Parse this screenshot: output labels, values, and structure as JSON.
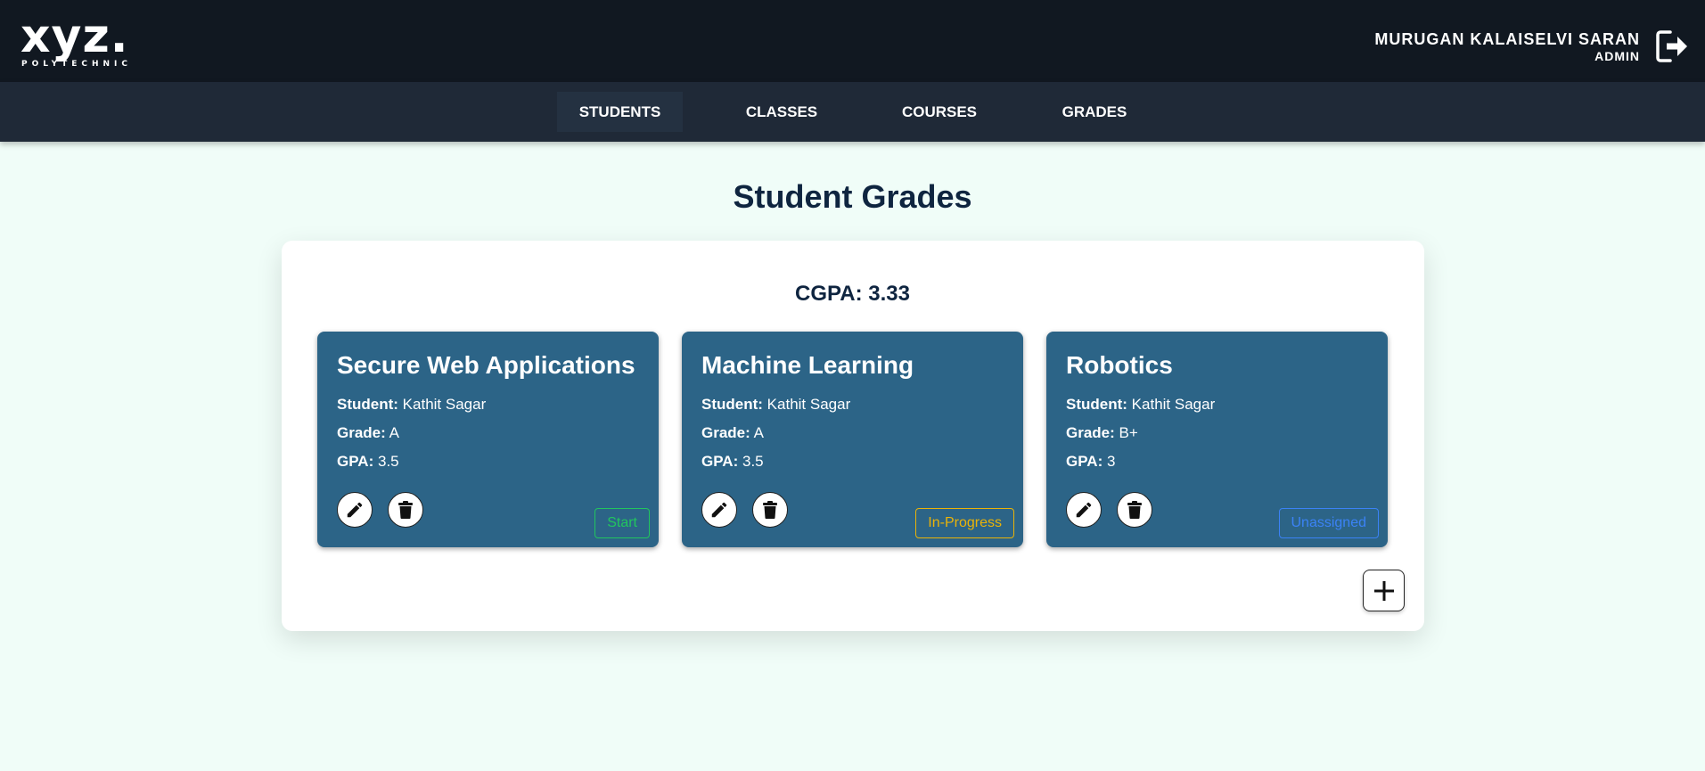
{
  "header": {
    "logo_text": "xyz.",
    "logo_subtext": "POLYTECHNIC",
    "user_name": "MURUGAN KALAISELVI SARAN",
    "user_role": "ADMIN"
  },
  "nav": {
    "items": [
      {
        "label": "STUDENTS",
        "active": true
      },
      {
        "label": "CLASSES",
        "active": false
      },
      {
        "label": "COURSES",
        "active": false
      },
      {
        "label": "GRADES",
        "active": false
      }
    ]
  },
  "main": {
    "title": "Student Grades",
    "cgpa_label": "CGPA:",
    "cgpa_value": "3.33",
    "field_labels": {
      "student": "Student:",
      "grade": "Grade:",
      "gpa": "GPA:"
    },
    "cards": [
      {
        "course": "Secure Web Applications",
        "student": "Kathit Sagar",
        "grade": "A",
        "gpa": "3.5",
        "status": "Start",
        "status_color": "#22c55e"
      },
      {
        "course": "Machine Learning",
        "student": "Kathit Sagar",
        "grade": "A",
        "gpa": "3.5",
        "status": "In-Progress",
        "status_color": "#eab308"
      },
      {
        "course": "Robotics",
        "student": "Kathit Sagar",
        "grade": "B+",
        "gpa": "3",
        "status": "Unassigned",
        "status_color": "#3b82f6"
      }
    ]
  },
  "colors": {
    "header_bg": "#111821",
    "nav_bg": "#1f2937",
    "page_bg": "#f0fdf8",
    "card_bg": "#2c6487",
    "title_color": "#0f2540"
  },
  "icons": [
    "logout-icon",
    "pencil-icon",
    "trash-icon",
    "plus-icon"
  ]
}
